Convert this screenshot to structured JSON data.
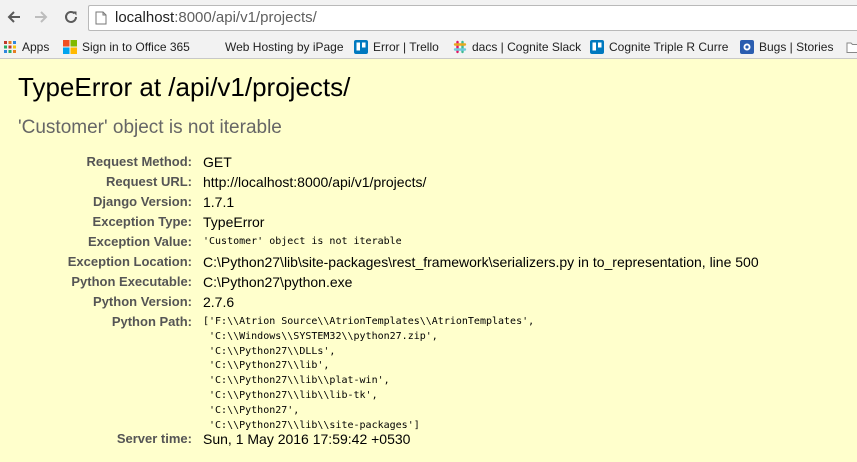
{
  "browser": {
    "url_host": "localhost",
    "url_rest": ":8000/api/v1/projects/",
    "bookmarks": [
      {
        "label": "Apps",
        "icon": "apps-grid-icon"
      },
      {
        "label": "Sign in to Office 365",
        "icon": "office-icon"
      },
      {
        "label": "Web Hosting by iPage",
        "icon": ""
      },
      {
        "label": "Error | Trello",
        "icon": "trello-icon"
      },
      {
        "label": "dacs | Cognite Slack",
        "icon": "slack-icon"
      },
      {
        "label": "Cognite Triple R Curre",
        "icon": "trello-icon"
      },
      {
        "label": "Bugs | Stories",
        "icon": "bugs-icon"
      }
    ]
  },
  "error": {
    "title": "TypeError at /api/v1/projects/",
    "subtitle": "'Customer' object is not iterable"
  },
  "meta": [
    {
      "label": "Request Method:",
      "value": "GET"
    },
    {
      "label": "Request URL:",
      "value": "http://localhost:8000/api/v1/projects/"
    },
    {
      "label": "Django Version:",
      "value": "1.7.1"
    },
    {
      "label": "Exception Type:",
      "value": "TypeError"
    },
    {
      "label": "Exception Value:",
      "value": "'Customer' object is not iterable"
    },
    {
      "label": "Exception Location:",
      "value": "C:\\Python27\\lib\\site-packages\\rest_framework\\serializers.py in to_representation, line 500"
    },
    {
      "label": "Python Executable:",
      "value": "C:\\Python27\\python.exe"
    },
    {
      "label": "Python Version:",
      "value": "2.7.6"
    },
    {
      "label": "Python Path:",
      "value": ""
    },
    {
      "label": "Server time:",
      "value": "Sun, 1 May 2016 17:59:42 +0530"
    }
  ],
  "python_path_lines": [
    "['F:\\\\Atrion Source\\\\AtrionTemplates\\\\AtrionTemplates',",
    " 'C:\\\\Windows\\\\SYSTEM32\\\\python27.zip',",
    " 'C:\\\\Python27\\\\DLLs',",
    " 'C:\\\\Python27\\\\lib',",
    " 'C:\\\\Python27\\\\lib\\\\plat-win',",
    " 'C:\\\\Python27\\\\lib\\\\lib-tk',",
    " 'C:\\\\Python27',",
    " 'C:\\\\Python27\\\\lib\\\\site-packages']"
  ],
  "colors": {
    "page_bg": "#ffffcc",
    "label": "#555555",
    "subtitle": "#666666"
  }
}
